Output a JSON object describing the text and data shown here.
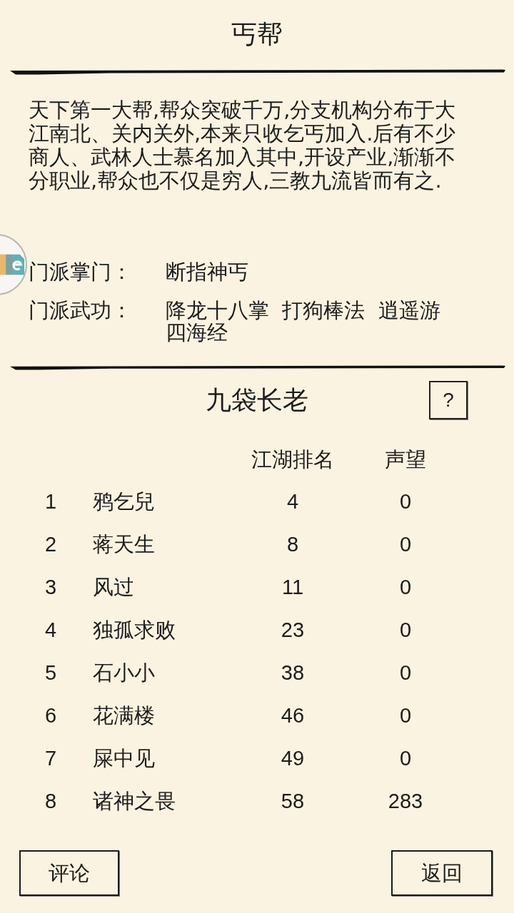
{
  "header": {
    "title": "丐帮"
  },
  "description": "天下第一大帮,帮众突破千万,分支机构分布于大江南北、关内关外,本来只收乞丐加入.后有不少商人、武林人士慕名加入其中,开设产业,渐渐不分职业,帮众也不仅是穷人,三教九流皆而有之.",
  "info": [
    {
      "label": "门派掌门：",
      "value": "断指神丐"
    },
    {
      "label": "门派武功：",
      "value": "降龙十八掌  打狗棒法  逍遥游四海经"
    }
  ],
  "ranking": {
    "title": "九袋长老",
    "help_button": "?",
    "columns": [
      "江湖排名",
      "声望"
    ],
    "rows": [
      {
        "index": "1",
        "name": "鸦乞兒",
        "rank": "4",
        "prestige": "0"
      },
      {
        "index": "2",
        "name": "蒋天生",
        "rank": "8",
        "prestige": "0"
      },
      {
        "index": "3",
        "name": "风过",
        "rank": "11",
        "prestige": "0"
      },
      {
        "index": "4",
        "name": "独孤求败",
        "rank": "23",
        "prestige": "0"
      },
      {
        "index": "5",
        "name": "石小小",
        "rank": "38",
        "prestige": "0"
      },
      {
        "index": "6",
        "name": "花满楼",
        "rank": "46",
        "prestige": "0"
      },
      {
        "index": "7",
        "name": "屎中见",
        "rank": "49",
        "prestige": "0"
      },
      {
        "index": "8",
        "name": "诸神之畏",
        "rank": "58",
        "prestige": "283"
      }
    ]
  },
  "bottom_bar": {
    "comment_button": "评论",
    "back_button": "返回"
  }
}
